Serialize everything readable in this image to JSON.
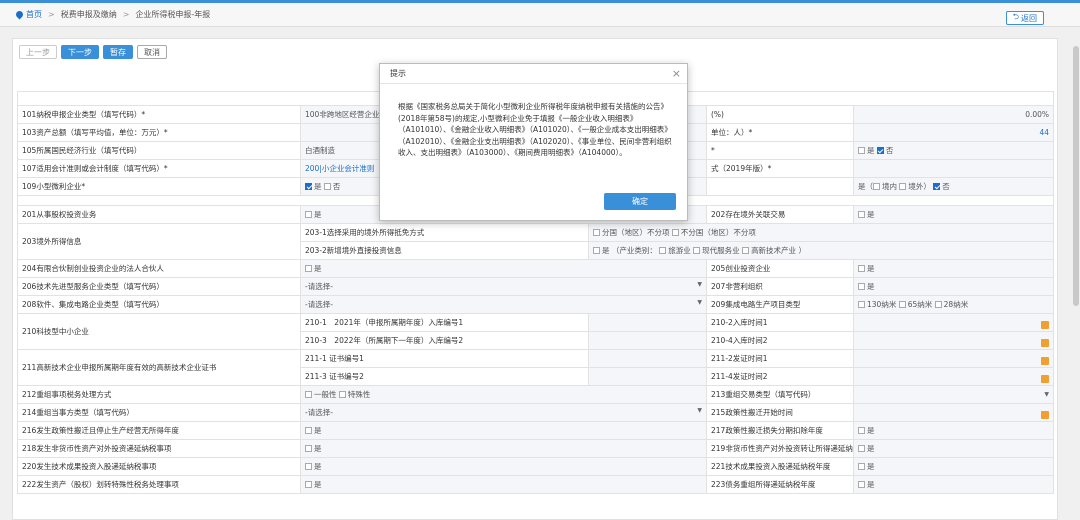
{
  "breadcrumb": {
    "home": "首页",
    "level1": "税费申报及缴纳",
    "level2": "企业所得税申报-年报"
  },
  "back_label": "返回",
  "toolbar": {
    "prev": "上一步",
    "next": "下一步",
    "save": "暂存",
    "cancel": "取消"
  },
  "rows": [
    {
      "c1": "101纳税申报企业类型（填写代码）*",
      "c2": "100非跨地区经营企业",
      "c3": "(%)",
      "c4": "0.00%"
    },
    {
      "c1": "103资产总额（填写平均值，单位：万元）*",
      "c2": "",
      "c3": "单位：人）*",
      "c4": "44"
    },
    {
      "c1": "105所属国民经济行业（填写代码）",
      "c2": "白酒制造",
      "c3": "*",
      "c4_yes": "是",
      "c4_no": "否"
    },
    {
      "c1": "107适用会计准则或会计制度（填写代码）*",
      "c2": "200|小企业会计准则",
      "c3": "式（2019年版）*",
      "c4": ""
    },
    {
      "c1": "109小型微利企业*",
      "c2_yes": "是",
      "c2_no": "否",
      "c4_a": "是（",
      "c4_b": "境内",
      "c4_c": "境外）",
      "c4_d": "否"
    }
  ],
  "sec2": {
    "r201": "201从事股权投资业务",
    "v201": "是",
    "r202": "202存在境外关联交易",
    "v202": "是",
    "r203": "203境外所得信息",
    "r203_1": "203-1选择采用的境外所得抵免方式",
    "v203_1a": "分国（地区）不分项",
    "v203_1b": "不分国（地区）不分项",
    "r203_2": "203-2新增境外直接投资信息",
    "v203_2": "是 （产业类别：",
    "v203_2b": "旅游业",
    "v203_2c": "现代服务业",
    "v203_2d": "高新技术产业 ）",
    "r204": "204有限合伙制创业投资企业的法人合伙人",
    "v204": "是",
    "r205": "205创业投资企业",
    "v205": "是",
    "r206": "206技术先进型服务企业类型（填写代码）",
    "v206": "-请选择-",
    "r207": "207非营利组织",
    "v207": "是",
    "r208": "208软件、集成电路企业类型（填写代码）",
    "v208": "-请选择-",
    "r209": "209集成电路生产项目类型",
    "v209a": "130纳米",
    "v209b": "65纳米",
    "v209c": "28纳米",
    "r210": "210科技型中小企业",
    "r210_1": "210-1　2021年（申报所属期年度）入库编号1",
    "r210_2": "210-2入库时间1",
    "r210_3": "210-3　2022年（所属期下一年度）入库编号2",
    "r210_4": "210-4入库时间2",
    "r211": "211高新技术企业申报所属期年度有效的高新技术企业证书",
    "r211_1": "211-1 证书编号1",
    "r211_2": "211-2发证时间1",
    "r211_3": "211-3 证书编号2",
    "r211_4": "211-4发证时间2",
    "r212": "212重组事项税务处理方式",
    "v212a": "一般性",
    "v212b": "特殊性",
    "r213": "213重组交易类型（填写代码）",
    "r214": "214重组当事方类型（填写代码）",
    "v214": "-请选择-",
    "r215": "215政策性搬迁开始时间",
    "r216": "216发生政策性搬迁且停止生产经营无所得年度",
    "v216": "是",
    "r217": "217政策性搬迁损失分期扣除年度",
    "v217": "是",
    "r218": "218发生非货币性资产对外投资递延纳税事项",
    "v218": "是",
    "r219": "219非货币性资产对外投资转让所得递延纳税年度",
    "v219": "是",
    "r220": "220发生技术成果投资入股递延纳税事项",
    "v220": "是",
    "r221": "221技术成果投资入股递延纳税年度",
    "v221": "是",
    "r222": "222发生资产（股权）划转特殊性税务处理事项",
    "v222": "是",
    "r223": "223债务重组所得递延纳税年度",
    "v223": "是"
  },
  "modal": {
    "title": "提示",
    "body": "根据《国家税务总局关于简化小型微利企业所得税年度纳税申报有关措施的公告》(2018年第58号)的规定,小型微利企业免于填报《一般企业收入明细表》（A101010）、《金融企业收入明细表》（A101020）、《一般企业成本支出明细表》（A102010）、《金融企业支出明细表》（A102020）、《事业单位、民间非营利组织收入、支出明细表》（A103000）、《期间费用明细表》（A104000）。",
    "ok": "确定"
  }
}
